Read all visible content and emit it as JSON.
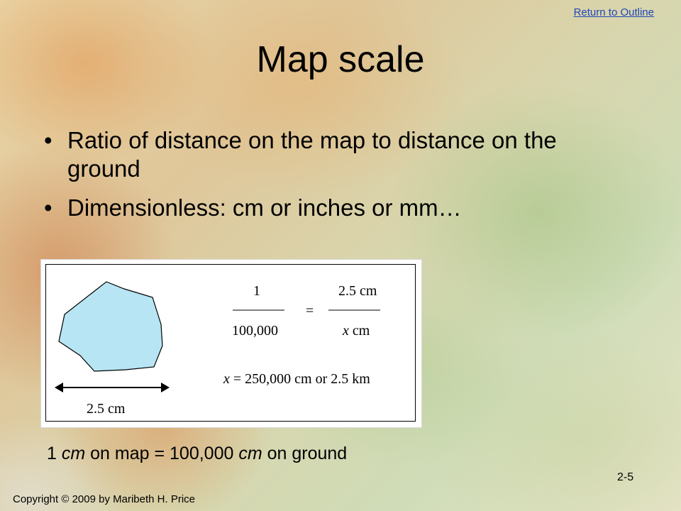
{
  "header": {
    "return_link": "Return to Outline"
  },
  "slide": {
    "title": "Map scale",
    "bullet_char": "•",
    "bullets": [
      "Ratio of distance on the map to distance on the ground",
      "Dimensionless: cm or inches or mm…"
    ]
  },
  "figure": {
    "scale_label": "2.5 cm",
    "left_numerator": "1",
    "left_denominator": "100,000",
    "equals": "=",
    "right_numerator": "2.5 cm",
    "right_denominator_var": "x",
    "right_denominator_unit": " cm",
    "result_var": "x",
    "result_text": " = 250,000 cm or 2.5 km",
    "shape_fill": "#b7e5f3"
  },
  "caption": {
    "part1": "1 ",
    "italic1": "cm",
    "part2": " on map = 100,000 ",
    "italic2": "cm",
    "part3": " on ground"
  },
  "footer": {
    "page_number": "2-5",
    "copyright": "Copyright © 2009 by Maribeth H. Price"
  }
}
